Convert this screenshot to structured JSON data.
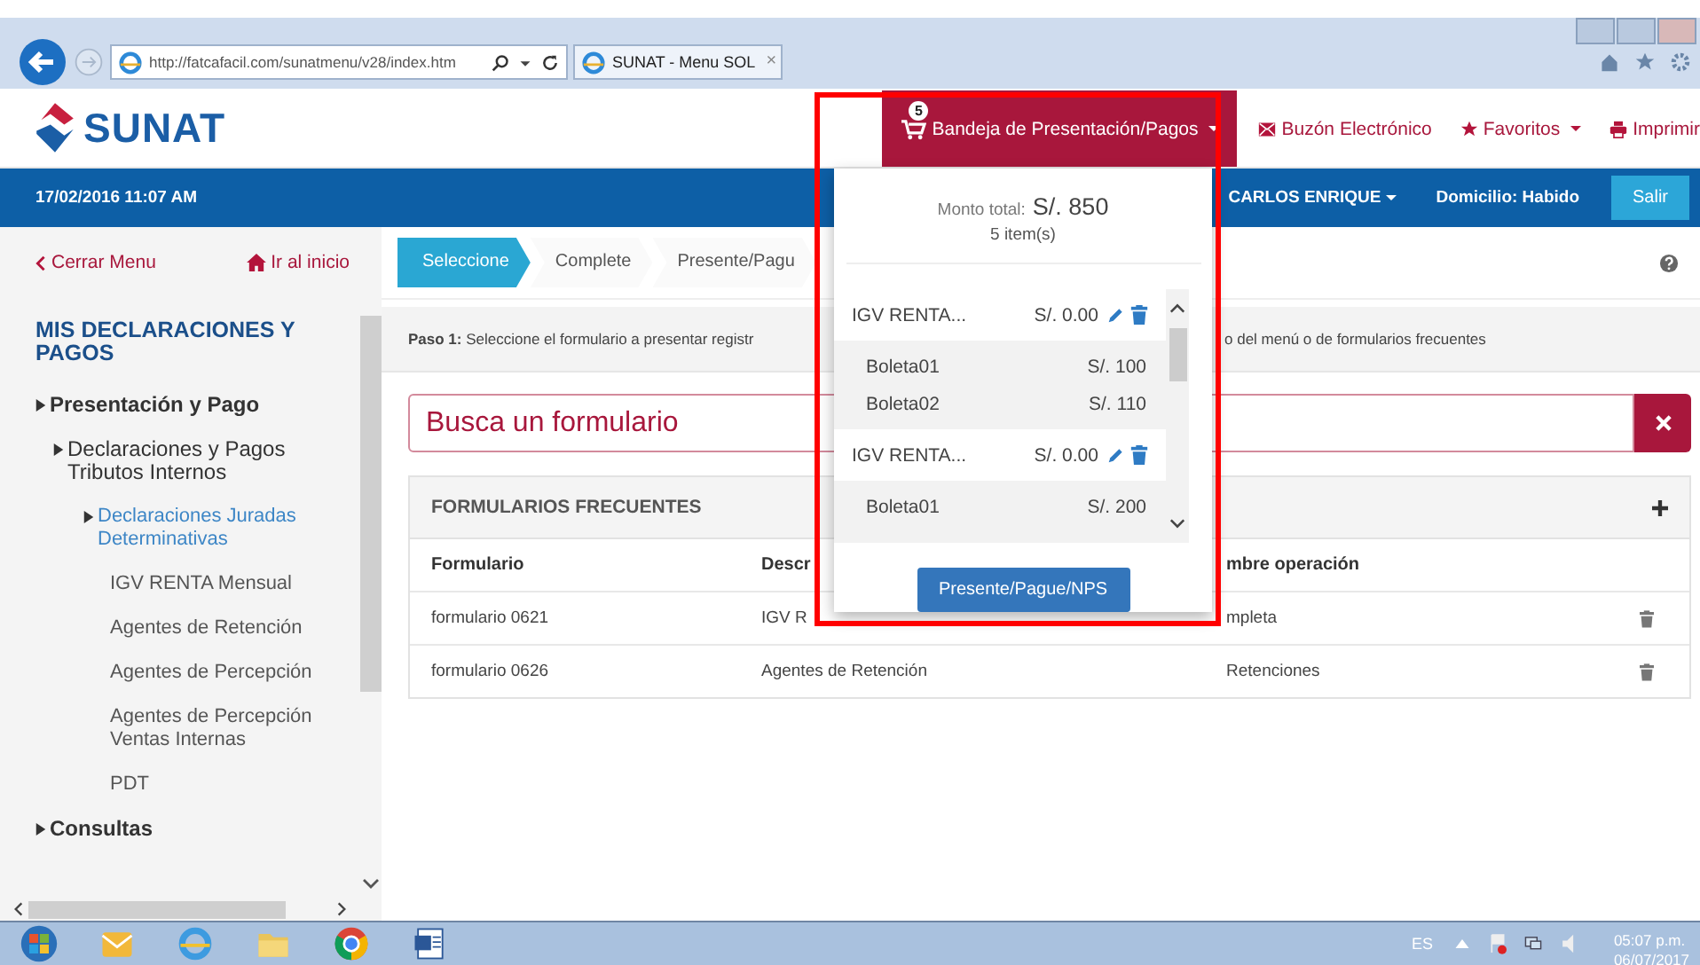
{
  "browser": {
    "address": "http://fatcafacil.com/sunatmenu/v28/index.htm",
    "tab_title": "SUNAT - Menu SOL",
    "tab_close": "×"
  },
  "header": {
    "logo": "SUNAT",
    "cart": {
      "badge": "5",
      "label": "Bandeja de Presentación/Pagos"
    },
    "nav": [
      {
        "label": "Buzón Electrónico",
        "kind": "envelope",
        "dropdown": false
      },
      {
        "label": "Favoritos",
        "kind": "star",
        "dropdown": true
      },
      {
        "label": "Imprimir",
        "kind": "printer",
        "dropdown": false
      }
    ]
  },
  "infobar": {
    "datetime": "17/02/2016 11:07 AM",
    "user": "CARLOS ENRIQUE",
    "address_status": "Domicilio: Habido",
    "logout": "Salir"
  },
  "sidebar": {
    "close": "Cerrar Menu",
    "home": "Ir al inicio",
    "heading": "MIS DECLARACIONES Y PAGOS",
    "tree": [
      {
        "label": "Presentación y Pago",
        "kind": "branch",
        "selected": false,
        "children": [
          {
            "label": "Declaraciones y Pagos Tributos Internos",
            "kind": "branch",
            "selected": false,
            "children": [
              {
                "label": "Declaraciones Juradas Determinativas",
                "kind": "branch",
                "selected": true,
                "children": [
                  {
                    "label": "IGV RENTA Mensual",
                    "kind": "leaf",
                    "selected": false
                  },
                  {
                    "label": "Agentes de Retención",
                    "kind": "leaf",
                    "selected": false
                  },
                  {
                    "label": "Agentes de Percepción",
                    "kind": "leaf",
                    "selected": false
                  },
                  {
                    "label": "Agentes de Percepción Ventas Internas",
                    "kind": "leaf",
                    "selected": false
                  },
                  {
                    "label": "PDT",
                    "kind": "leaf",
                    "selected": false
                  }
                ]
              }
            ]
          }
        ]
      },
      {
        "label": "Consultas",
        "kind": "branch",
        "selected": false
      }
    ]
  },
  "steps": [
    {
      "label": "Seleccione",
      "selected": true
    },
    {
      "label": "Complete",
      "selected": false
    },
    {
      "label": "Presente/Pagu",
      "selected": false
    }
  ],
  "step_hint": {
    "left": "**Paso 1:** Seleccione el formulario a presentar registr",
    "right": "o del menú o de formularios frecuentes"
  },
  "search": {
    "placeholder": "Busca un formulario"
  },
  "frequent": {
    "title": "FORMULARIOS FRECUENTES",
    "columns": [
      "Formulario",
      "Descr",
      "mbre operación"
    ],
    "rows": [
      [
        "formulario 0621",
        "IGV R",
        "mpleta"
      ],
      [
        "formulario 0626",
        "Agentes de Retención",
        "Retenciones"
      ]
    ]
  },
  "cart_panel": {
    "total_label": "Monto total:",
    "total": "S/. 850",
    "count": "5 item(s)",
    "groups": [
      {
        "name": "IGV RENTA...",
        "amount": "S/. 0.00",
        "items": [
          {
            "name": "Boleta01",
            "amount": "S/. 100"
          },
          {
            "name": "Boleta02",
            "amount": "S/. 110"
          }
        ]
      },
      {
        "name": "IGV RENTA...",
        "amount": "S/. 0.00",
        "items": [
          {
            "name": "Boleta01",
            "amount": "S/. 200"
          }
        ]
      }
    ],
    "button": "Presente/Pague/NPS"
  },
  "taskbar": {
    "language": "ES",
    "time": "05:07 p.m.",
    "date": "06/07/2017"
  }
}
